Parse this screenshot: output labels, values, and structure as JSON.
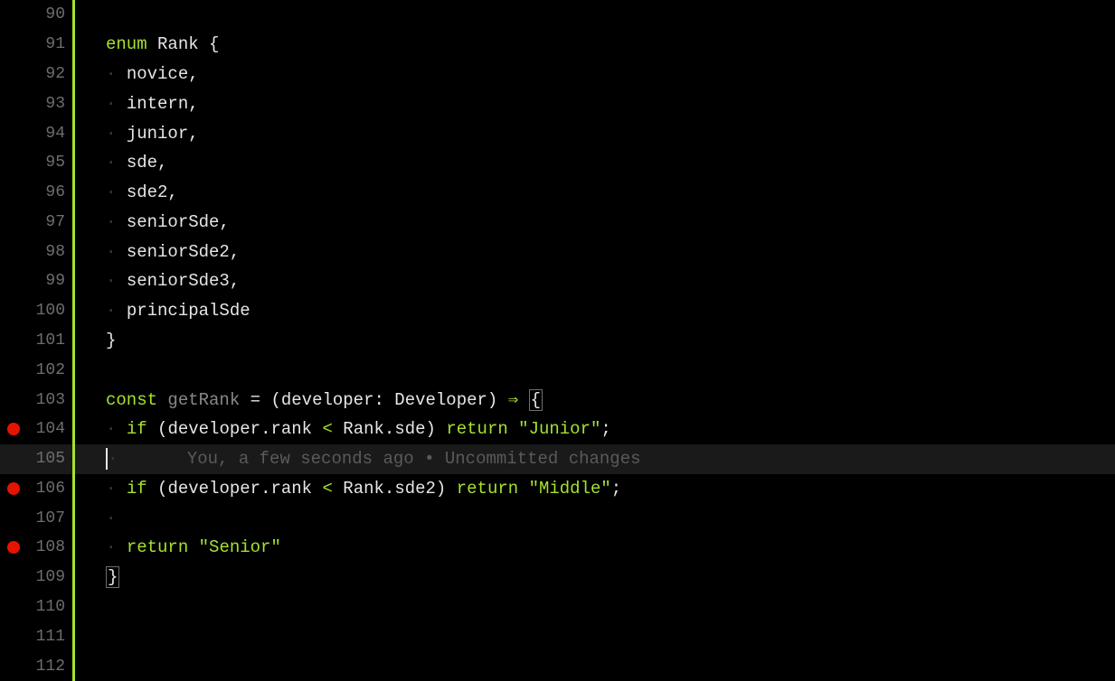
{
  "lines": [
    {
      "num": "90",
      "bp": false,
      "tokens": []
    },
    {
      "num": "91",
      "bp": false,
      "tokens": [
        {
          "t": "enum ",
          "c": "kw"
        },
        {
          "t": "Rank ",
          "c": "type"
        },
        {
          "t": "{",
          "c": "punc"
        }
      ]
    },
    {
      "num": "92",
      "bp": false,
      "tokens": [
        {
          "t": "· ",
          "c": "guide"
        },
        {
          "t": "novice",
          "c": "fn"
        },
        {
          "t": ",",
          "c": "punc"
        }
      ]
    },
    {
      "num": "93",
      "bp": false,
      "tokens": [
        {
          "t": "· ",
          "c": "guide"
        },
        {
          "t": "intern",
          "c": "fn"
        },
        {
          "t": ",",
          "c": "punc"
        }
      ]
    },
    {
      "num": "94",
      "bp": false,
      "tokens": [
        {
          "t": "· ",
          "c": "guide"
        },
        {
          "t": "junior",
          "c": "fn"
        },
        {
          "t": ",",
          "c": "punc"
        }
      ]
    },
    {
      "num": "95",
      "bp": false,
      "tokens": [
        {
          "t": "· ",
          "c": "guide"
        },
        {
          "t": "sde",
          "c": "fn"
        },
        {
          "t": ",",
          "c": "punc"
        }
      ]
    },
    {
      "num": "96",
      "bp": false,
      "tokens": [
        {
          "t": "· ",
          "c": "guide"
        },
        {
          "t": "sde2",
          "c": "fn"
        },
        {
          "t": ",",
          "c": "punc"
        }
      ]
    },
    {
      "num": "97",
      "bp": false,
      "tokens": [
        {
          "t": "· ",
          "c": "guide"
        },
        {
          "t": "seniorSde",
          "c": "fn"
        },
        {
          "t": ",",
          "c": "punc"
        }
      ]
    },
    {
      "num": "98",
      "bp": false,
      "tokens": [
        {
          "t": "· ",
          "c": "guide"
        },
        {
          "t": "seniorSde2",
          "c": "fn"
        },
        {
          "t": ",",
          "c": "punc"
        }
      ]
    },
    {
      "num": "99",
      "bp": false,
      "tokens": [
        {
          "t": "· ",
          "c": "guide"
        },
        {
          "t": "seniorSde3",
          "c": "fn"
        },
        {
          "t": ",",
          "c": "punc"
        }
      ]
    },
    {
      "num": "100",
      "bp": false,
      "tokens": [
        {
          "t": "· ",
          "c": "guide"
        },
        {
          "t": "principalSde",
          "c": "fn"
        }
      ]
    },
    {
      "num": "101",
      "bp": false,
      "tokens": [
        {
          "t": "}",
          "c": "punc"
        }
      ]
    },
    {
      "num": "102",
      "bp": false,
      "tokens": []
    },
    {
      "num": "103",
      "bp": false,
      "tokens": [
        {
          "t": "const ",
          "c": "kw"
        },
        {
          "t": "getRank",
          "c": "dim"
        },
        {
          "t": " = (",
          "c": "punc"
        },
        {
          "t": "developer",
          "c": "param"
        },
        {
          "t": ": ",
          "c": "punc"
        },
        {
          "t": "Developer",
          "c": "ptype"
        },
        {
          "t": ") ",
          "c": "punc"
        },
        {
          "t": "⇒",
          "c": "arrow"
        },
        {
          "t": " ",
          "c": "punc"
        },
        {
          "t": "{",
          "c": "punc",
          "box": true
        }
      ]
    },
    {
      "num": "104",
      "bp": true,
      "tokens": [
        {
          "t": "· ",
          "c": "guide"
        },
        {
          "t": "if ",
          "c": "kw"
        },
        {
          "t": "(",
          "c": "punc"
        },
        {
          "t": "developer",
          "c": "fn"
        },
        {
          "t": ".",
          "c": "punc"
        },
        {
          "t": "rank ",
          "c": "fn"
        },
        {
          "t": "< ",
          "c": "op"
        },
        {
          "t": "Rank",
          "c": "type"
        },
        {
          "t": ".",
          "c": "punc"
        },
        {
          "t": "sde",
          "c": "fn"
        },
        {
          "t": ") ",
          "c": "punc"
        },
        {
          "t": "return ",
          "c": "kw"
        },
        {
          "t": "\"Junior\"",
          "c": "str"
        },
        {
          "t": ";",
          "c": "punc"
        }
      ]
    },
    {
      "num": "105",
      "bp": false,
      "current": true,
      "cursor": true,
      "tokens": [
        {
          "t": "·      ",
          "c": "guide"
        }
      ],
      "blame": "You, a few seconds ago • Uncommitted changes"
    },
    {
      "num": "106",
      "bp": true,
      "tokens": [
        {
          "t": "· ",
          "c": "guide"
        },
        {
          "t": "if ",
          "c": "kw"
        },
        {
          "t": "(",
          "c": "punc"
        },
        {
          "t": "developer",
          "c": "fn"
        },
        {
          "t": ".",
          "c": "punc"
        },
        {
          "t": "rank ",
          "c": "fn"
        },
        {
          "t": "< ",
          "c": "op"
        },
        {
          "t": "Rank",
          "c": "type"
        },
        {
          "t": ".",
          "c": "punc"
        },
        {
          "t": "sde2",
          "c": "fn"
        },
        {
          "t": ") ",
          "c": "punc"
        },
        {
          "t": "return ",
          "c": "kw"
        },
        {
          "t": "\"Middle\"",
          "c": "str"
        },
        {
          "t": ";",
          "c": "punc"
        }
      ]
    },
    {
      "num": "107",
      "bp": false,
      "tokens": [
        {
          "t": "·",
          "c": "guide"
        }
      ]
    },
    {
      "num": "108",
      "bp": true,
      "tokens": [
        {
          "t": "· ",
          "c": "guide"
        },
        {
          "t": "return ",
          "c": "kw"
        },
        {
          "t": "\"Senior\"",
          "c": "str"
        }
      ]
    },
    {
      "num": "109",
      "bp": false,
      "tokens": [
        {
          "t": "}",
          "c": "punc",
          "box": true
        }
      ]
    },
    {
      "num": "110",
      "bp": false,
      "tokens": []
    },
    {
      "num": "111",
      "bp": false,
      "tokens": []
    },
    {
      "num": "112",
      "bp": false,
      "tokens": []
    }
  ]
}
